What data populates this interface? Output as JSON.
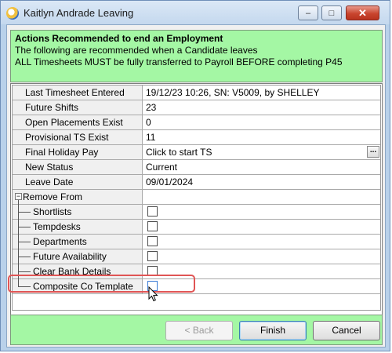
{
  "window": {
    "title": "Kaitlyn Andrade Leaving",
    "min_glyph": "‒",
    "max_glyph": "□",
    "close_glyph": "✕"
  },
  "header": {
    "title": "Actions Recommended to end an Employment",
    "line1": "The following are recommended when a Candidate leaves",
    "line2": "ALL Timesheets MUST be fully transferred to Payroll BEFORE completing P45",
    "background": "#a4f7a4"
  },
  "grid": {
    "last_timesheet": {
      "label": "Last Timesheet Entered",
      "value": "19/12/23 10:26, SN: V5009, by SHELLEY"
    },
    "future_shifts": {
      "label": "Future Shifts",
      "value": "23"
    },
    "open_placements": {
      "label": "Open Placements Exist",
      "value": "0"
    },
    "provisional_ts": {
      "label": "Provisional TS Exist",
      "value": "11"
    },
    "final_holiday_pay": {
      "label": "Final Holiday Pay",
      "value": "Click to start TS",
      "button": "..."
    },
    "new_status": {
      "label": "New Status",
      "value": "Current"
    },
    "leave_date": {
      "label": "Leave Date",
      "value": "09/01/2024"
    },
    "remove_from": {
      "label": "Remove From",
      "expander": "−",
      "items": [
        {
          "label": "Shortlists",
          "checked": false
        },
        {
          "label": "Tempdesks",
          "checked": false
        },
        {
          "label": "Departments",
          "checked": false
        },
        {
          "label": "Future Availability",
          "checked": false
        },
        {
          "label": "Clear Bank Details",
          "checked": false
        },
        {
          "label": "Composite Co Template",
          "checked": false
        }
      ]
    }
  },
  "buttons": {
    "back": "< Back",
    "finish": "Finish",
    "cancel": "Cancel"
  },
  "colors": {
    "accent_green": "#a4f7a4",
    "highlight_red": "#e05555"
  }
}
